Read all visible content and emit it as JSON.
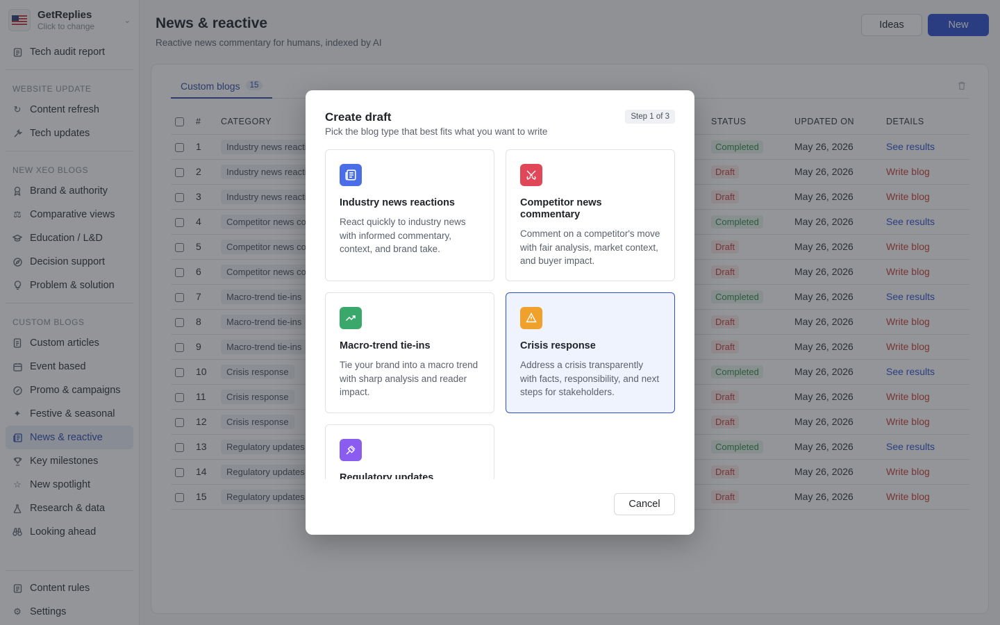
{
  "workspace": {
    "name": "GetReplies",
    "subtitle": "Click to change"
  },
  "sidebar": {
    "top_items": [
      {
        "label": "Tech audit report",
        "icon": "clipboard-icon"
      }
    ],
    "sections": [
      {
        "title": "WEBSITE UPDATE",
        "items": [
          {
            "label": "Content refresh",
            "icon": "refresh-icon"
          },
          {
            "label": "Tech updates",
            "icon": "wrench-icon"
          }
        ]
      },
      {
        "title": "NEW XEO BLOGS",
        "items": [
          {
            "label": "Brand & authority",
            "icon": "award-icon"
          },
          {
            "label": "Comparative views",
            "icon": "scale-icon"
          },
          {
            "label": "Education / L&D",
            "icon": "graduation-cap-icon"
          },
          {
            "label": "Decision support",
            "icon": "compass-icon"
          },
          {
            "label": "Problem & solution",
            "icon": "lightbulb-icon"
          }
        ]
      },
      {
        "title": "CUSTOM BLOGS",
        "items": [
          {
            "label": "Custom articles",
            "icon": "document-icon"
          },
          {
            "label": "Event based",
            "icon": "calendar-icon"
          },
          {
            "label": "Promo & campaigns",
            "icon": "badge-percent-icon"
          },
          {
            "label": "Festive & seasonal",
            "icon": "sparkles-icon"
          },
          {
            "label": "News & reactive",
            "icon": "newspaper-icon",
            "active": true
          },
          {
            "label": "Key milestones",
            "icon": "trophy-icon"
          },
          {
            "label": "New spotlight",
            "icon": "star-icon"
          },
          {
            "label": "Research & data",
            "icon": "flask-icon"
          },
          {
            "label": "Looking ahead",
            "icon": "binoculars-icon"
          }
        ]
      }
    ],
    "bottom_items": [
      {
        "label": "Content rules",
        "icon": "rules-icon"
      },
      {
        "label": "Settings",
        "icon": "gear-icon"
      }
    ]
  },
  "header": {
    "title": "News & reactive",
    "subtitle": "Reactive news commentary for humans, indexed by AI",
    "ideas_label": "Ideas",
    "new_label": "New"
  },
  "tab": {
    "label": "Custom blogs",
    "count": "15"
  },
  "table": {
    "columns": [
      "#",
      "CATEGORY",
      "STATUS",
      "UPDATED ON",
      "DETAILS"
    ],
    "rows": [
      {
        "num": "1",
        "category": "Industry news reacti",
        "status": "Completed",
        "updated": "May 26, 2026",
        "details": "See results"
      },
      {
        "num": "2",
        "category": "Industry news reacti",
        "status": "Draft",
        "updated": "May 26, 2026",
        "details": "Write blog"
      },
      {
        "num": "3",
        "category": "Industry news reacti",
        "status": "Draft",
        "updated": "May 26, 2026",
        "details": "Write blog"
      },
      {
        "num": "4",
        "category": "Competitor news co",
        "status": "Completed",
        "updated": "May 26, 2026",
        "details": "See results"
      },
      {
        "num": "5",
        "category": "Competitor news co",
        "status": "Draft",
        "updated": "May 26, 2026",
        "details": "Write blog"
      },
      {
        "num": "6",
        "category": "Competitor news co",
        "status": "Draft",
        "updated": "May 26, 2026",
        "details": "Write blog"
      },
      {
        "num": "7",
        "category": "Macro-trend tie-ins",
        "status": "Completed",
        "updated": "May 26, 2026",
        "details": "See results"
      },
      {
        "num": "8",
        "category": "Macro-trend tie-ins",
        "status": "Draft",
        "updated": "May 26, 2026",
        "details": "Write blog"
      },
      {
        "num": "9",
        "category": "Macro-trend tie-ins",
        "status": "Draft",
        "updated": "May 26, 2026",
        "details": "Write blog"
      },
      {
        "num": "10",
        "category": "Crisis response",
        "status": "Completed",
        "updated": "May 26, 2026",
        "details": "See results"
      },
      {
        "num": "11",
        "category": "Crisis response",
        "status": "Draft",
        "updated": "May 26, 2026",
        "details": "Write blog"
      },
      {
        "num": "12",
        "category": "Crisis response",
        "status": "Draft",
        "updated": "May 26, 2026",
        "details": "Write blog"
      },
      {
        "num": "13",
        "category": "Regulatory updates",
        "status": "Completed",
        "updated": "May 26, 2026",
        "details": "See results"
      },
      {
        "num": "14",
        "category": "Regulatory updates",
        "status": "Draft",
        "updated": "May 26, 2026",
        "details": "Write blog"
      },
      {
        "num": "15",
        "category": "Regulatory updates",
        "status": "Draft",
        "updated": "May 26, 2026",
        "details": "Write blog"
      }
    ]
  },
  "modal": {
    "title": "Create draft",
    "subtitle": "Pick the blog type that best fits what you want to write",
    "step": "Step 1 of 3",
    "options": [
      {
        "title": "Industry news reactions",
        "desc": "React quickly to industry news with informed commentary, context, and brand take.",
        "icon": "newspaper-icon",
        "color": "#4a6ee8"
      },
      {
        "title": "Competitor news commentary",
        "desc": "Comment on a competitor's move with fair analysis, market context, and buyer impact.",
        "icon": "swords-icon",
        "color": "#e0485a"
      },
      {
        "title": "Macro-trend tie-ins",
        "desc": "Tie your brand into a macro trend with sharp analysis and reader impact.",
        "icon": "trending-up-icon",
        "color": "#3aa86a"
      },
      {
        "title": "Crisis response",
        "desc": "Address a crisis transparently with facts, responsibility, and next steps for stakeholders.",
        "icon": "warning-icon",
        "color": "#f0a12c",
        "selected": true
      },
      {
        "title": "Regulatory updates",
        "desc": "",
        "icon": "gavel-icon",
        "color": "#8a5cf0"
      }
    ],
    "cancel_label": "Cancel"
  }
}
